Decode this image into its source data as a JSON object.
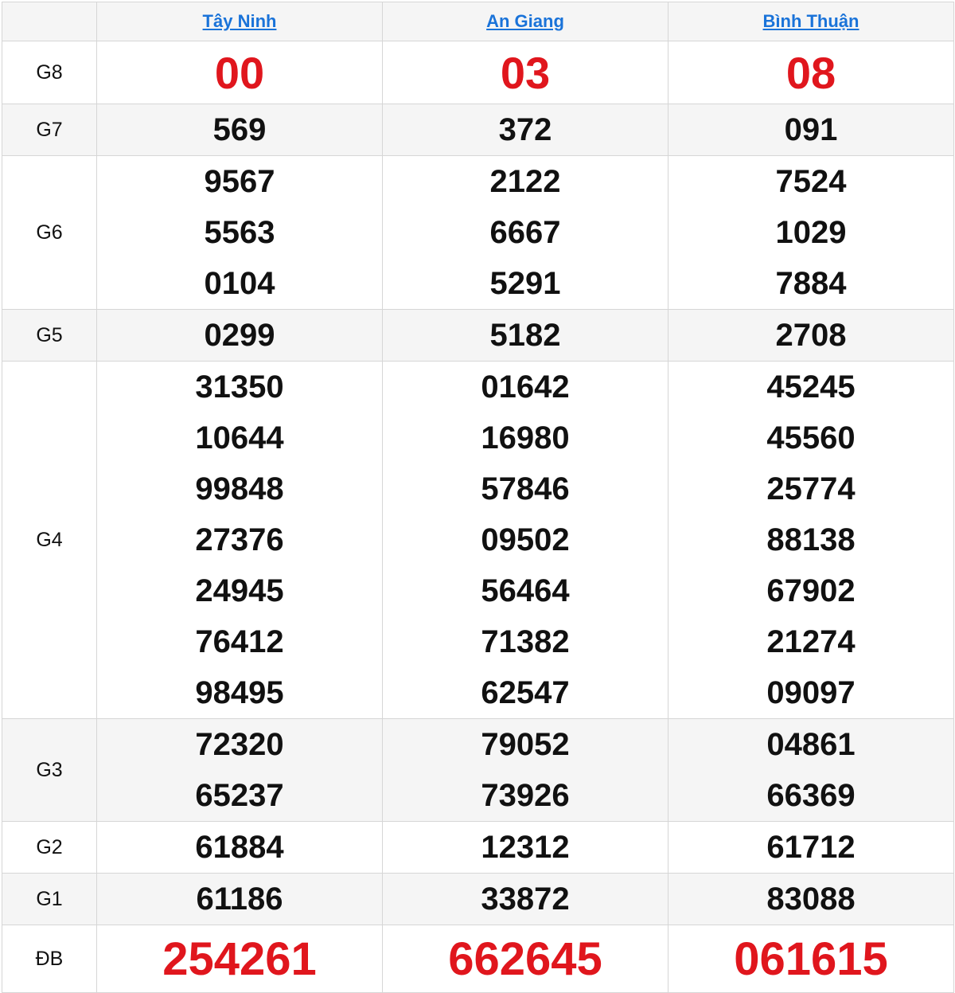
{
  "provinces": [
    "Tây Ninh",
    "An Giang",
    "Bình Thuận"
  ],
  "prizes": [
    {
      "label": "G8",
      "style": "big",
      "values": [
        [
          "00"
        ],
        [
          "03"
        ],
        [
          "08"
        ]
      ]
    },
    {
      "label": "G7",
      "style": "normal",
      "values": [
        [
          "569"
        ],
        [
          "372"
        ],
        [
          "091"
        ]
      ]
    },
    {
      "label": "G6",
      "style": "normal",
      "values": [
        [
          "9567",
          "5563",
          "0104"
        ],
        [
          "2122",
          "6667",
          "5291"
        ],
        [
          "7524",
          "1029",
          "7884"
        ]
      ]
    },
    {
      "label": "G5",
      "style": "normal",
      "values": [
        [
          "0299"
        ],
        [
          "5182"
        ],
        [
          "2708"
        ]
      ]
    },
    {
      "label": "G4",
      "style": "normal",
      "values": [
        [
          "31350",
          "10644",
          "99848",
          "27376",
          "24945",
          "76412",
          "98495"
        ],
        [
          "01642",
          "16980",
          "57846",
          "09502",
          "56464",
          "71382",
          "62547"
        ],
        [
          "45245",
          "45560",
          "25774",
          "88138",
          "67902",
          "21274",
          "09097"
        ]
      ]
    },
    {
      "label": "G3",
      "style": "normal",
      "values": [
        [
          "72320",
          "65237"
        ],
        [
          "79052",
          "73926"
        ],
        [
          "04861",
          "66369"
        ]
      ]
    },
    {
      "label": "G2",
      "style": "normal",
      "values": [
        [
          "61884"
        ],
        [
          "12312"
        ],
        [
          "61712"
        ]
      ]
    },
    {
      "label": "G1",
      "style": "normal",
      "values": [
        [
          "61186"
        ],
        [
          "33872"
        ],
        [
          "83088"
        ]
      ]
    },
    {
      "label": "ĐB",
      "style": "big",
      "values": [
        [
          "254261"
        ],
        [
          "662645"
        ],
        [
          "061615"
        ]
      ]
    }
  ],
  "colors": {
    "accent_red": "#e0161d",
    "link_blue": "#1a73d9",
    "row_alt": "#f5f5f5",
    "border": "#d6d6d6"
  }
}
